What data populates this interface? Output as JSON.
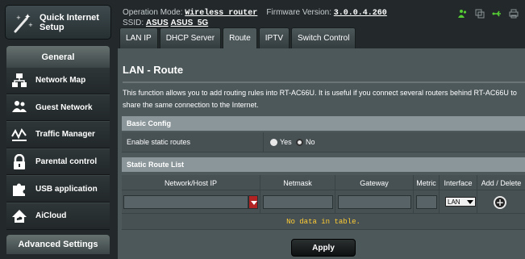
{
  "sidebar": {
    "quick_setup_label": "Quick Internet Setup",
    "general_header": "General",
    "items": [
      {
        "label": "Network Map",
        "icon": "network-map-icon"
      },
      {
        "label": "Guest Network",
        "icon": "guest-network-icon"
      },
      {
        "label": "Traffic Manager",
        "icon": "traffic-manager-icon"
      },
      {
        "label": "Parental control",
        "icon": "lock-icon"
      },
      {
        "label": "USB application",
        "icon": "puzzle-icon"
      },
      {
        "label": "AiCloud",
        "icon": "cloud-home-icon"
      }
    ],
    "advanced_header": "Advanced Settings"
  },
  "header": {
    "op_mode_label": "Operation Mode:",
    "op_mode_value": "Wireless router",
    "fw_label": "Firmware Version:",
    "fw_value": "3.0.0.4.260",
    "ssid_label": "SSID:",
    "ssid_1": "ASUS",
    "ssid_2": "ASUS_5G",
    "status_icons": [
      "users-icon",
      "copy-icon",
      "usb-icon",
      "printer-icon"
    ],
    "status_colors": {
      "active": "#55cc33",
      "inactive": "#8a9396"
    }
  },
  "tabs": [
    {
      "label": "LAN IP",
      "active": false
    },
    {
      "label": "DHCP Server",
      "active": false
    },
    {
      "label": "Route",
      "active": true
    },
    {
      "label": "IPTV",
      "active": false
    },
    {
      "label": "Switch Control",
      "active": false
    }
  ],
  "main": {
    "title": "LAN - Route",
    "description": "This function allows you to add routing rules into RT-AC66U. It is useful if you connect several routers behind RT-AC66U to share the same connection to the Internet.",
    "basic_config": {
      "header": "Basic Config",
      "enable_label": "Enable static routes",
      "yes_label": "Yes",
      "no_label": "No",
      "selected": "Yes"
    },
    "route_list": {
      "header": "Static Route List",
      "columns": [
        "Network/Host IP",
        "Netmask",
        "Gateway",
        "Metric",
        "Interface",
        "Add / Delete"
      ],
      "interface_value": "LAN",
      "add_symbol": "+",
      "empty_text": "No data in table."
    },
    "apply_label": "Apply"
  },
  "colors": {
    "panel_bg": "#4d585b",
    "table_header": "#8b969a",
    "empty_text": "#ffcc33",
    "accent_red": "#b22323"
  }
}
